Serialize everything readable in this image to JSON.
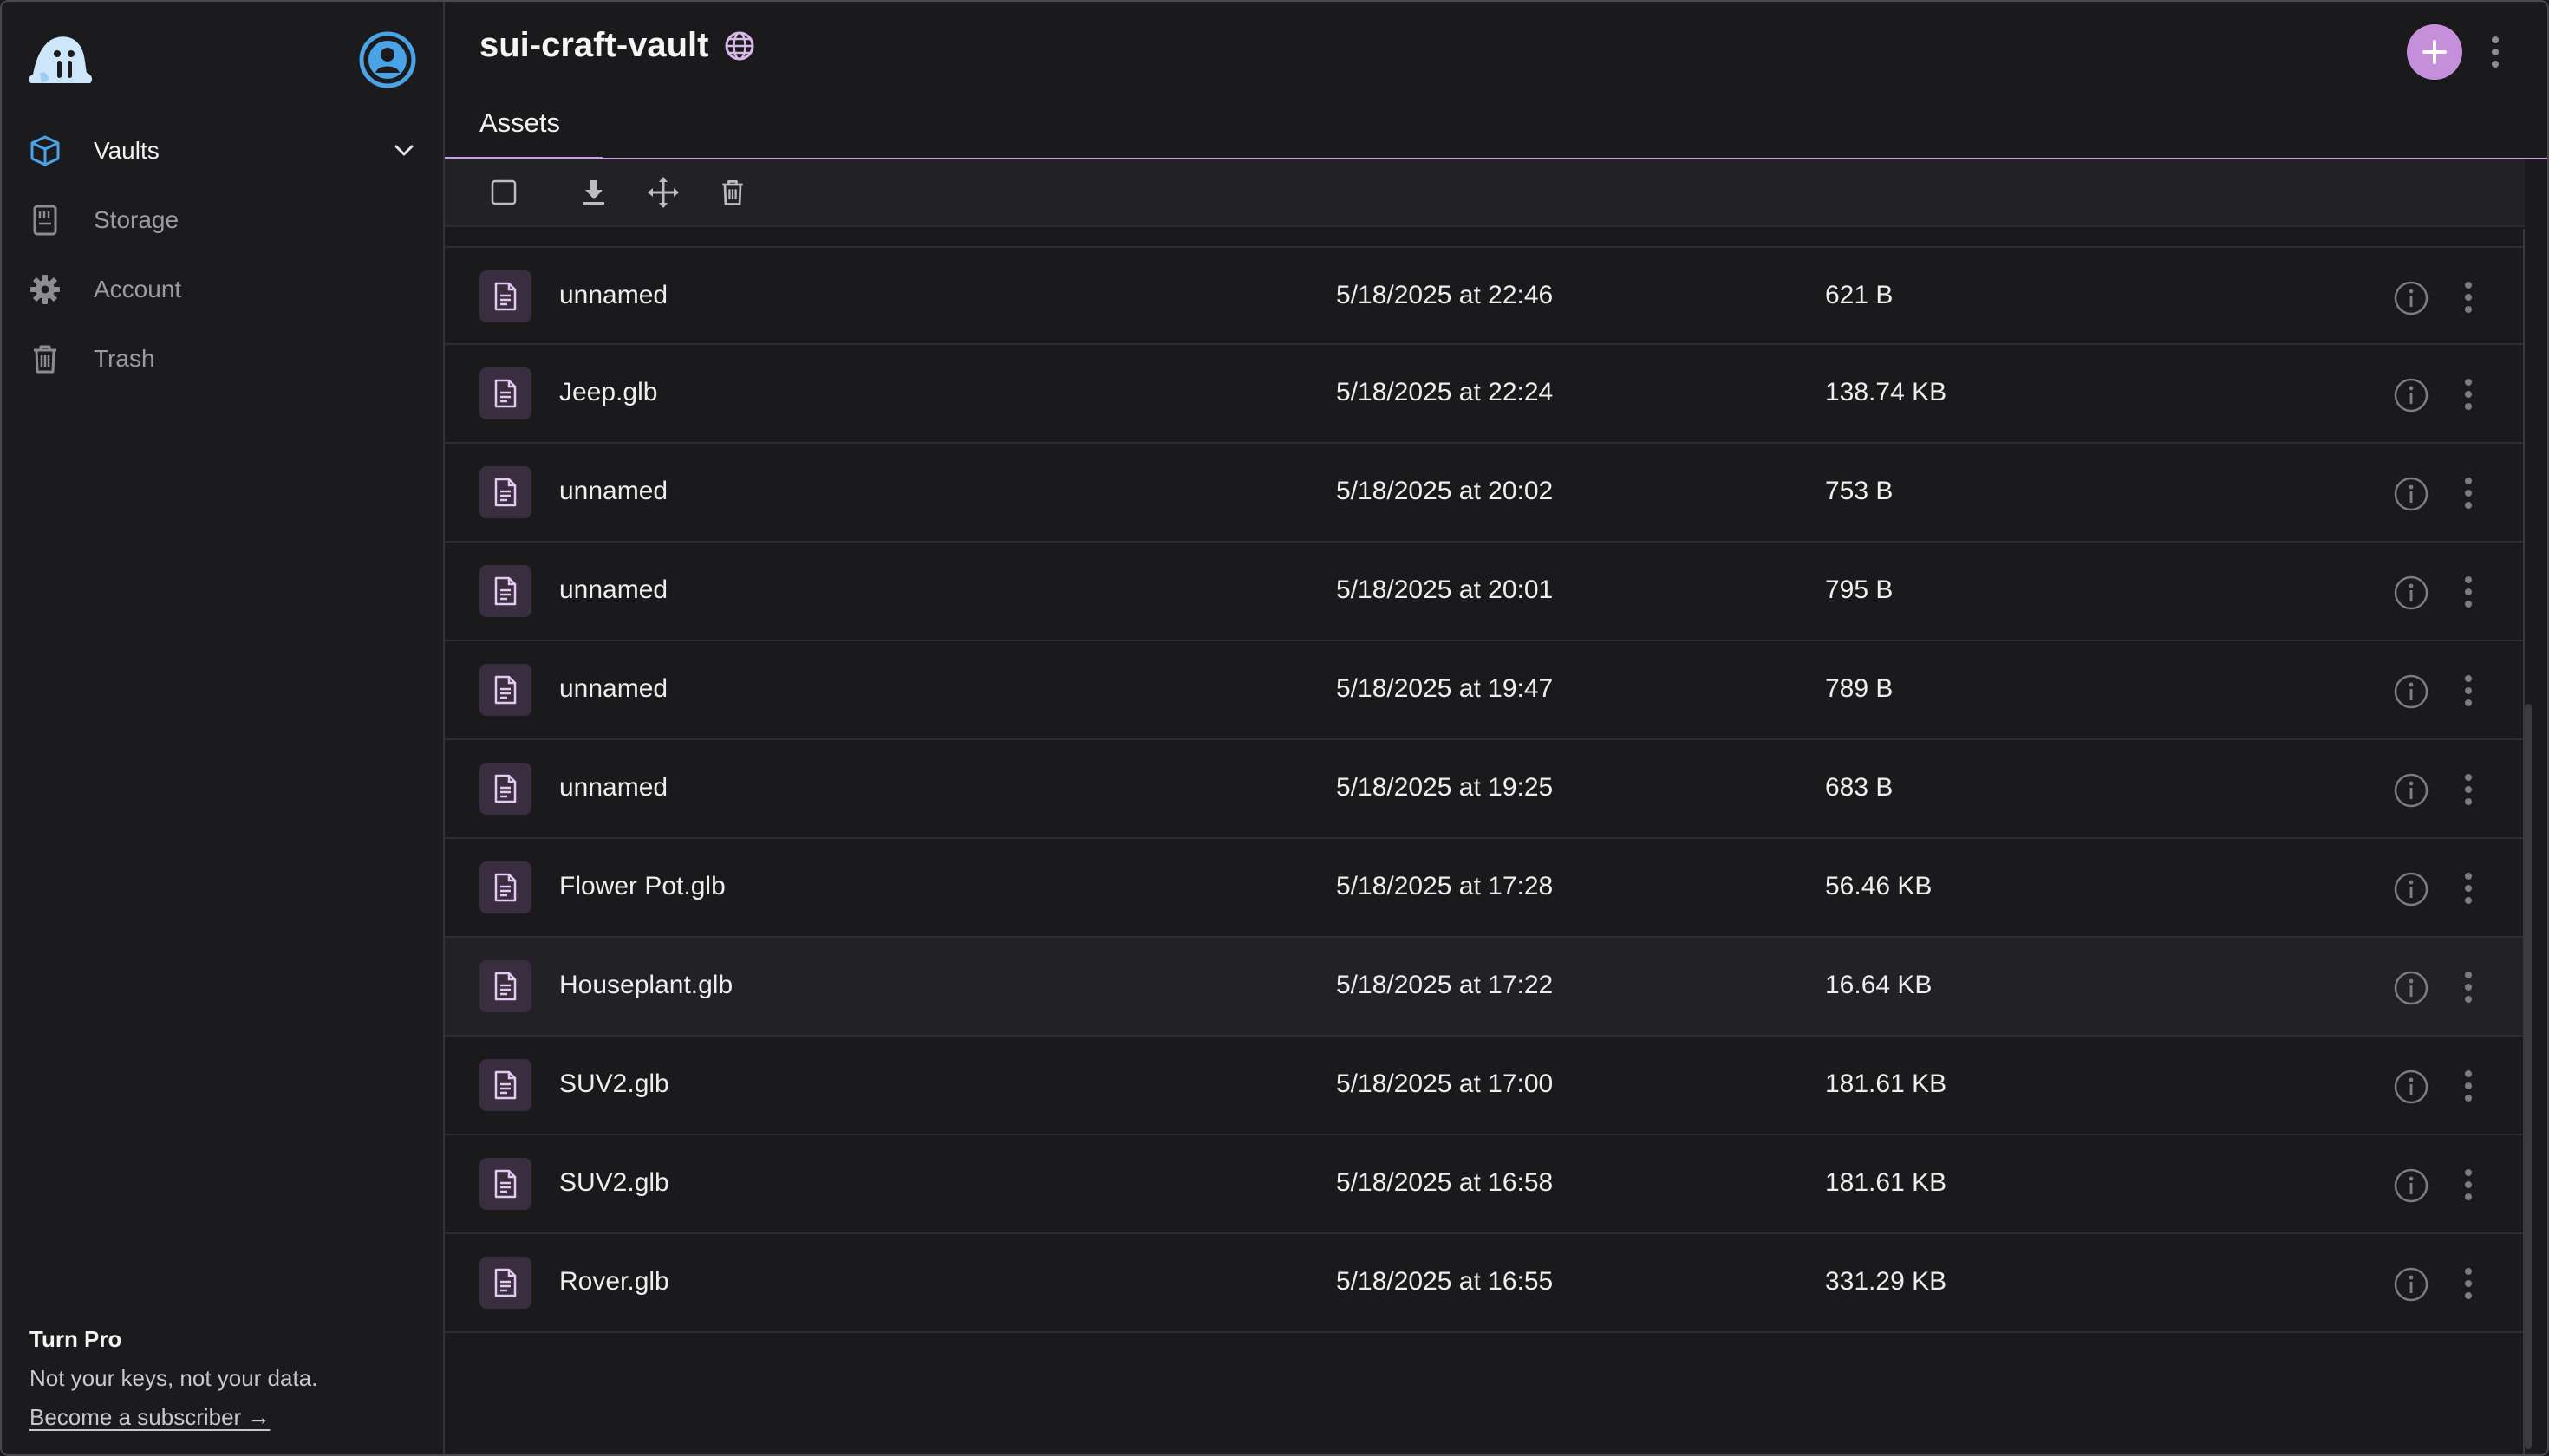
{
  "sidebar": {
    "nav": [
      {
        "label": "Vaults",
        "icon": "cube-icon",
        "active": true
      },
      {
        "label": "Storage",
        "icon": "storage-card-icon"
      },
      {
        "label": "Account",
        "icon": "gear-icon"
      },
      {
        "label": "Trash",
        "icon": "trash-icon"
      }
    ],
    "promo": {
      "title": "Turn Pro",
      "subtitle": "Not your keys, not your data.",
      "link": "Become a subscriber →"
    }
  },
  "header": {
    "title": "sui-craft-vault"
  },
  "tabs": [
    {
      "label": "Assets",
      "active": true
    }
  ],
  "files": [
    {
      "name": "unnamed",
      "date": "5/18/2025 at 22:46",
      "size": "621 B"
    },
    {
      "name": "Jeep.glb",
      "date": "5/18/2025 at 22:24",
      "size": "138.74 KB"
    },
    {
      "name": "unnamed",
      "date": "5/18/2025 at 20:02",
      "size": "753 B"
    },
    {
      "name": "unnamed",
      "date": "5/18/2025 at 20:01",
      "size": "795 B"
    },
    {
      "name": "unnamed",
      "date": "5/18/2025 at 19:47",
      "size": "789 B"
    },
    {
      "name": "unnamed",
      "date": "5/18/2025 at 19:25",
      "size": "683 B"
    },
    {
      "name": "Flower Pot.glb",
      "date": "5/18/2025 at 17:28",
      "size": "56.46 KB"
    },
    {
      "name": "Houseplant.glb",
      "date": "5/18/2025 at 17:22",
      "size": "16.64 KB",
      "highlighted": true
    },
    {
      "name": "SUV2.glb",
      "date": "5/18/2025 at 17:00",
      "size": "181.61 KB"
    },
    {
      "name": "SUV2.glb",
      "date": "5/18/2025 at 16:58",
      "size": "181.61 KB"
    },
    {
      "name": "Rover.glb",
      "date": "5/18/2025 at 16:55",
      "size": "331.29 KB"
    }
  ],
  "colors": {
    "accent": "#c58fda",
    "brand_blue": "#4aa3e6",
    "background": "#1a191c"
  }
}
